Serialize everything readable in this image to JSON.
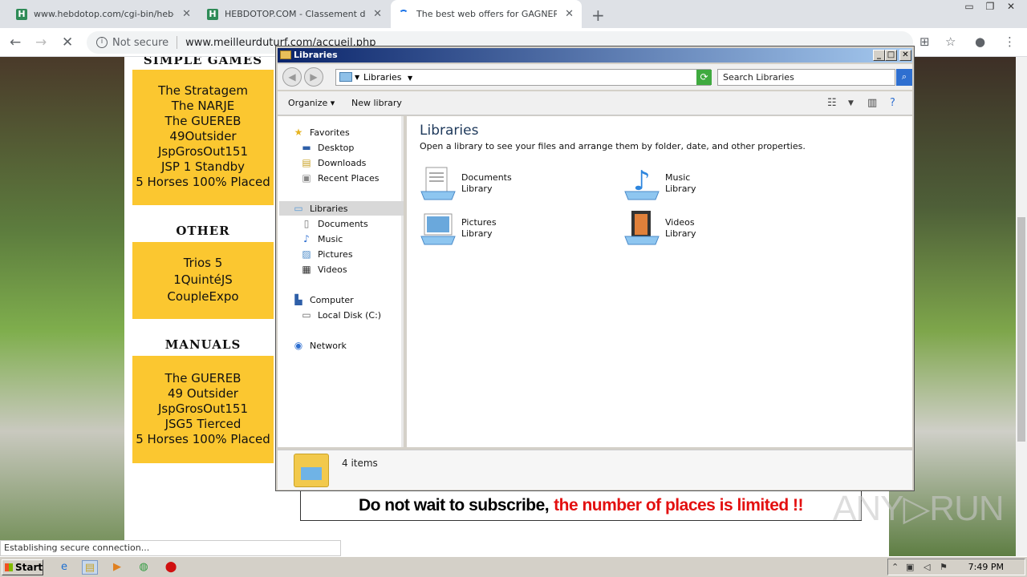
{
  "browser": {
    "tabs": [
      {
        "favicon": "H",
        "title": "www.hebdotop.com/cgi-bin/hebdoto",
        "active": false
      },
      {
        "favicon": "H",
        "title": "HEBDOTOP.COM - Classement de sit",
        "active": false
      },
      {
        "favicon": "",
        "title": "The best web offers for GAGNER AU",
        "active": true
      }
    ],
    "url_security": "Not secure",
    "url": "www.meilleurduturf.com/accueil.php",
    "status_text": "Establishing secure connection..."
  },
  "webpage": {
    "simple_games": {
      "title": "SIMPLE GAMES",
      "items": [
        "The Stratagem",
        "The NARJE",
        "The GUEREB",
        "49Outsider",
        "JspGrosOut151",
        "JSP 1 Standby",
        "5 Horses 100% Placed"
      ]
    },
    "other": {
      "title": "OTHER",
      "items": [
        "Trios 5",
        "1QuintéJS",
        "CoupleExpo"
      ]
    },
    "manuals": {
      "title": "MANUALS",
      "items": [
        "The GUEREB",
        "49 Outsider",
        "JspGrosOut151",
        "JSG5 Tierced",
        "5 Horses 100% Placed"
      ]
    },
    "subscribe_black": "Do not wait to subscribe,",
    "subscribe_red": "the number of places is limited !!",
    "watermark": "ANY▷RUN"
  },
  "explorer": {
    "title": "Libraries",
    "address": "Libraries",
    "search_placeholder": "Search Libraries",
    "commands": {
      "organize": "Organize",
      "new_library": "New library"
    },
    "nav": {
      "favorites": "Favorites",
      "desktop": "Desktop",
      "downloads": "Downloads",
      "recent": "Recent Places",
      "libraries": "Libraries",
      "documents": "Documents",
      "music": "Music",
      "pictures": "Pictures",
      "videos": "Videos",
      "computer": "Computer",
      "local_disk": "Local Disk (C:)",
      "network": "Network"
    },
    "main_title": "Libraries",
    "main_desc": "Open a library to see your files and arrange them by folder, date, and other properties.",
    "libraries": [
      {
        "name": "Documents",
        "type": "Library"
      },
      {
        "name": "Music",
        "type": "Library"
      },
      {
        "name": "Pictures",
        "type": "Library"
      },
      {
        "name": "Videos",
        "type": "Library"
      }
    ],
    "item_count": "4 items"
  },
  "taskbar": {
    "start": "Start",
    "clock": "7:49 PM"
  }
}
